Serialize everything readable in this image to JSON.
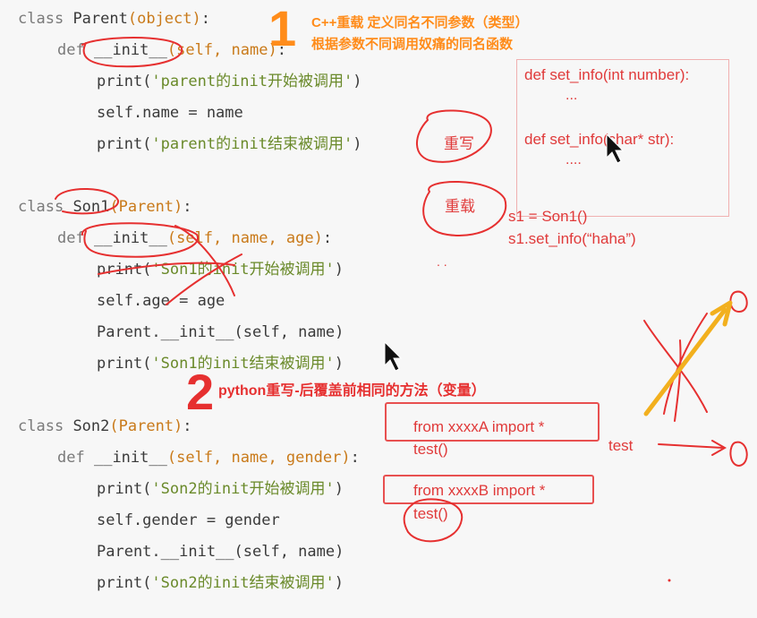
{
  "code": {
    "parent_class": {
      "kw": "class",
      "name": "Parent",
      "base": "(object)",
      "colon": ":"
    },
    "parent_init_def": {
      "kw": "def",
      "name": "__init__",
      "args": "(self, name)",
      "colon": ":"
    },
    "parent_print_start": {
      "fn": "print(",
      "str": "'parent的init开始被调用'",
      "end": ")"
    },
    "parent_assign": "self.name = name",
    "parent_print_end": {
      "fn": "print(",
      "str": "'parent的init结束被调用'",
      "end": ")"
    },
    "son1_class": {
      "kw": "class",
      "name": "Son1",
      "base": "(Parent)",
      "colon": ":"
    },
    "son1_init_def": {
      "kw": "def",
      "name": "__init__",
      "args": "(self, name, age)",
      "colon": ":"
    },
    "son1_print_start": {
      "fn": "print(",
      "str": "'Son1的init开始被调用'",
      "end": ")"
    },
    "son1_assign": "self.age = age",
    "son1_super_call": "Parent.__init__(self, name)",
    "son1_print_end": {
      "fn": "print(",
      "str": "'Son1的init结束被调用'",
      "end": ")"
    },
    "son2_class": {
      "kw": "class",
      "name": "Son2",
      "base": "(Parent)",
      "colon": ":"
    },
    "son2_init_def": {
      "kw": "def",
      "name": "__init__",
      "args": "(self, name, gender)",
      "colon": ":"
    },
    "son2_print_start": {
      "fn": "print(",
      "str": "'Son2的init开始被调用'",
      "end": ")"
    },
    "son2_assign": "self.gender = gender",
    "son2_super_call": "Parent.__init__(self, name)",
    "son2_print_end": {
      "fn": "print(",
      "str": "'Son2的init结束被调用'",
      "end": ")"
    }
  },
  "annotations": {
    "num_1": "1",
    "num_2": "2",
    "overload_line1": "C++重载 定义同名不同参数（类型）",
    "overload_line2": "根据参数不同调用奴痛的同名函数",
    "override_label": "重写",
    "overload_label": "重载",
    "cpp_def1": "def set_info(int number):",
    "cpp_dots1": "...",
    "cpp_def2": "def set_info(char* str):",
    "cpp_dots2": "....",
    "s1_assign": "s1 = Son1()",
    "s1_call": "s1.set_info(“haha”)",
    "python_override": "python重写-后覆盖前相同的方法（变量）",
    "import_a": "from xxxxA import *",
    "test_a": "test()",
    "import_b": "from xxxxB import *",
    "test_b": "test()",
    "test_label": "test",
    "dots": ". ."
  },
  "colors": {
    "annotation_red": "#e03a3a",
    "number_orange": "#ff8c1a",
    "string_green": "#6a8a2a",
    "param_orange": "#c97a1a"
  }
}
